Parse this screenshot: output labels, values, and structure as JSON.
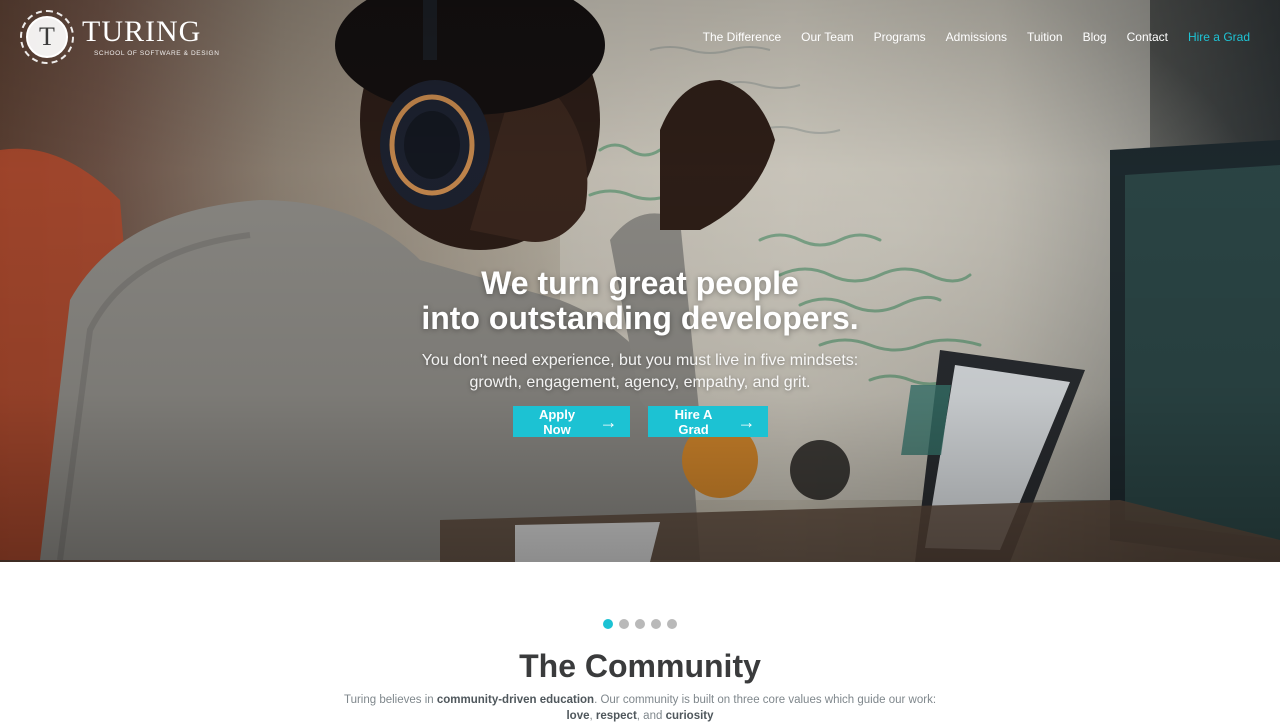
{
  "brand": {
    "seal_letter": "T",
    "name": "TURING",
    "tagline": "SCHOOL OF SOFTWARE & DESIGN"
  },
  "nav": {
    "items": [
      {
        "label": "The Difference"
      },
      {
        "label": "Our Team"
      },
      {
        "label": "Programs"
      },
      {
        "label": "Admissions"
      },
      {
        "label": "Tuition"
      },
      {
        "label": "Blog"
      },
      {
        "label": "Contact"
      },
      {
        "label": "Hire a Grad"
      }
    ]
  },
  "hero": {
    "title_line1": "We turn great people",
    "title_line2": "into outstanding developers.",
    "subtitle_line1": "You don't need experience, but you must live in five mindsets:",
    "subtitle_line2": "growth, engagement, agency, empathy, and grit.",
    "apply_label": "Apply Now",
    "hire_label": "Hire A Grad",
    "arrow_glyph": "→"
  },
  "carousel": {
    "count": 5,
    "active_index": 0
  },
  "community": {
    "title": "The Community",
    "body_pre": "Turing believes in ",
    "body_bold1": "community-driven education",
    "body_mid": ". Our community is built on three core values which guide our work:",
    "line2_bold1": "love",
    "sep1": ", ",
    "line2_bold2": "respect",
    "sep2": ", and ",
    "line2_bold3": "curiosity"
  },
  "colors": {
    "accent": "#1cc2d3",
    "heading": "#3a3b3c",
    "body_text": "#7f878c",
    "dot_inactive": "#b9b9b9"
  },
  "icons": {
    "cta_arrow": "arrow-right-icon",
    "seal": "turing-seal-logo"
  }
}
